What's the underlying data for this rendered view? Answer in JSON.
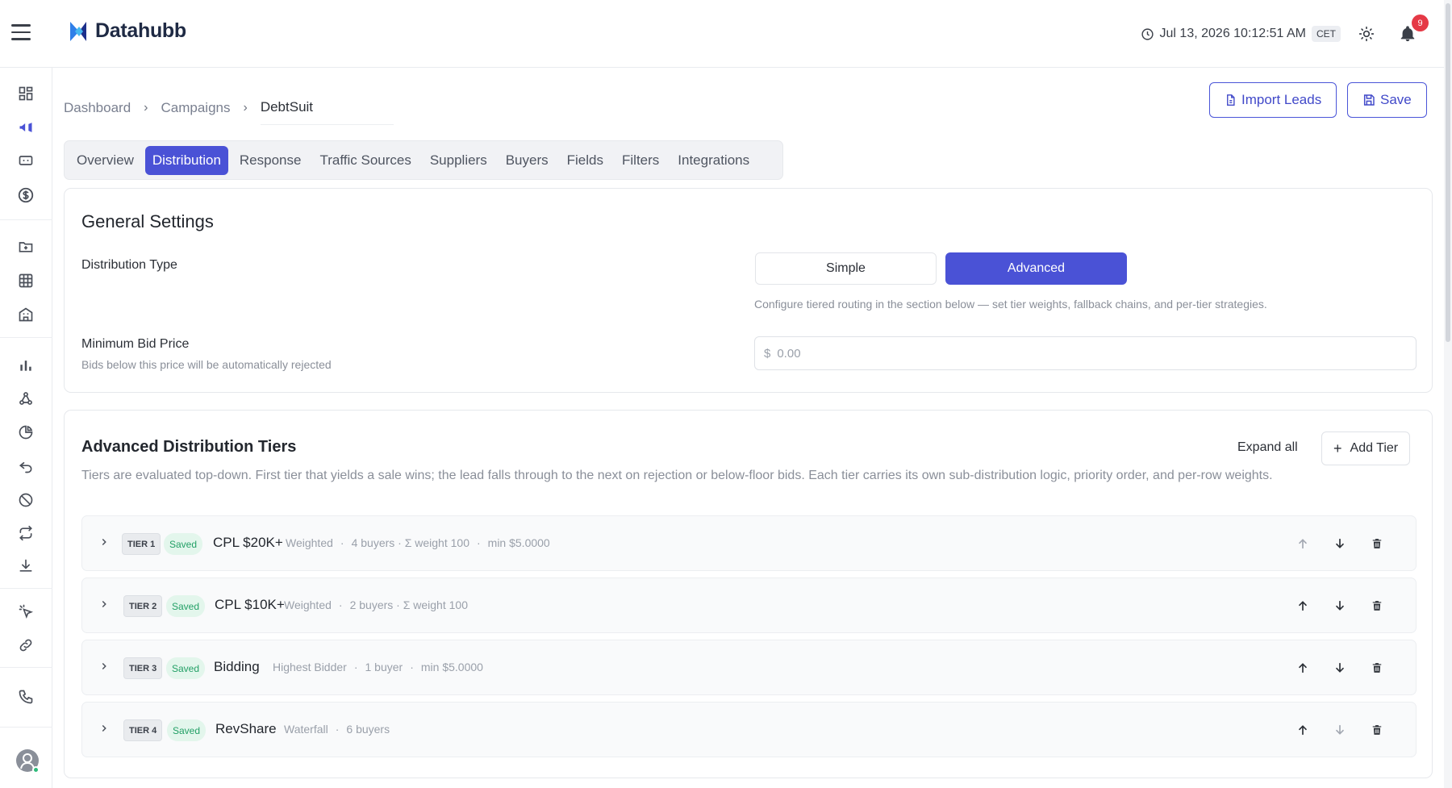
{
  "app": {
    "name": "Datahubb",
    "datetime": "Jul 13, 2026 10:12:51 AM",
    "timezone": "CET",
    "notification_count": "9"
  },
  "breadcrumb": [
    "Dashboard",
    "Campaigns",
    "DebtSuit"
  ],
  "actions": {
    "import_label": "Import Leads",
    "save_label": "Save"
  },
  "tabs": [
    "Overview",
    "Distribution",
    "Response",
    "Traffic Sources",
    "Suppliers",
    "Buyers",
    "Fields",
    "Filters",
    "Integrations"
  ],
  "active_tab": "Distribution",
  "general": {
    "title": "General Settings",
    "distribution_type_label": "Distribution Type",
    "options": [
      "Simple",
      "Advanced"
    ],
    "selected": "Advanced",
    "hint": "Configure tiered routing in the section below — set tier weights, fallback chains, and per-tier strategies.",
    "min_bid_label": "Minimum Bid Price",
    "min_bid_help": "Bids below this price will be automatically rejected",
    "currency": "$",
    "min_bid_placeholder": "0.00"
  },
  "advanced": {
    "title": "Advanced Distribution Tiers",
    "expand_all": "Expand all",
    "add_tier": "Add Tier",
    "description": "Tiers are evaluated top-down. First tier that yields a sale wins; the lead falls through to the next on rejection or below-floor bids. Each tier carries its own sub-distribution logic, priority order, and per-row weights.",
    "tiers": [
      {
        "badge": "TIER 1",
        "status": "Saved",
        "name": "CPL $20K+",
        "strategy": "Weighted",
        "buyers": "4 buyers · Σ weight 100",
        "min": "min $5.0000"
      },
      {
        "badge": "TIER 2",
        "status": "Saved",
        "name": "CPL $10K+",
        "strategy": "Weighted",
        "buyers": "2 buyers · Σ weight 100",
        "min": ""
      },
      {
        "badge": "TIER 3",
        "status": "Saved",
        "name": "Bidding",
        "strategy": "Highest Bidder",
        "buyers": "1 buyer",
        "min": "min $5.0000"
      },
      {
        "badge": "TIER 4",
        "status": "Saved",
        "name": "RevShare",
        "strategy": "Waterfall",
        "buyers": "6 buyers",
        "min": ""
      }
    ]
  },
  "colors": {
    "accent": "#4a52d6",
    "saved_green": "#23a066",
    "notification_red": "#e53946"
  }
}
